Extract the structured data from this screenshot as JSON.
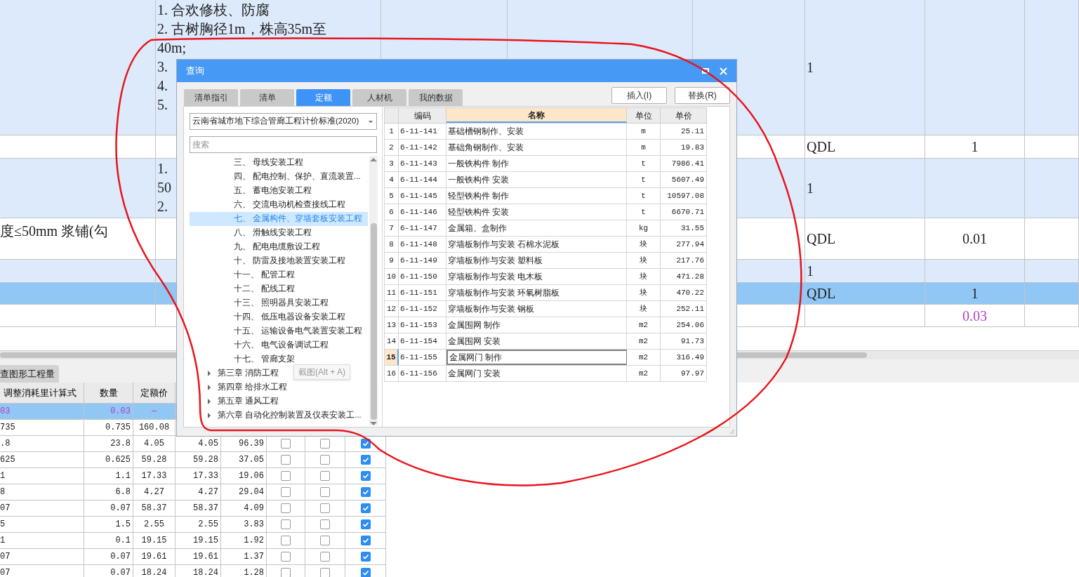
{
  "sheet": {
    "rows": [
      {
        "kind": "group",
        "selected": false,
        "modified": false,
        "column_2": [
          "1. 合欢修枝、防腐",
          "2. 古树胸径1m，株高35m至",
          "40m;",
          "3.",
          "4.",
          "5."
        ],
        "column_6": "1"
      },
      {
        "kind": "item",
        "selected": false,
        "modified": false,
        "column_6": "QDL",
        "column_7": "1"
      },
      {
        "kind": "group",
        "selected": false,
        "modified": false,
        "column_2": [
          "1.",
          "50",
          "2."
        ],
        "column_6": "1"
      },
      {
        "kind": "item",
        "selected": false,
        "modified": false,
        "column_1": "度≤50mm 浆铺(勾",
        "column_6": "QDL",
        "column_7": "0.01"
      },
      {
        "kind": "group",
        "selected": false,
        "modified": false,
        "column_6": "1"
      },
      {
        "kind": "item",
        "selected": true,
        "modified": false,
        "column_6": "QDL",
        "column_7": "1"
      },
      {
        "kind": "item",
        "selected": false,
        "modified": true,
        "column_7": "0.03"
      }
    ]
  },
  "bottom_tabs": [
    {
      "label": "查图形工程量",
      "selected": true
    }
  ],
  "bottom_table": {
    "columns": [
      "调整消耗里计算式",
      "数量",
      "定额价"
    ],
    "rows": [
      {
        "selected": true,
        "modified": true,
        "column_1": "03",
        "quantity": "0.03",
        "quota_price": "—"
      },
      {
        "selected": false,
        "modified": false,
        "column_1": "735",
        "quantity": "0.735",
        "quota_price": "160.08"
      },
      {
        "selected": false,
        "modified": false,
        "column_1": ".8",
        "quantity": "23.8",
        "quota_price": "4.05",
        "column_4": "4.05",
        "column_5": "96.39",
        "checks": [
          {
            "checked": false
          },
          {
            "checked": false
          },
          {
            "checked": true
          }
        ]
      },
      {
        "selected": false,
        "modified": false,
        "column_1": "625",
        "quantity": "0.625",
        "quota_price": "59.28",
        "column_4": "59.28",
        "column_5": "37.05",
        "checks": [
          {
            "checked": false
          },
          {
            "checked": false
          },
          {
            "checked": true
          }
        ]
      },
      {
        "selected": false,
        "modified": false,
        "column_1": "1",
        "quantity": "1.1",
        "quota_price": "17.33",
        "column_4": "17.33",
        "column_5": "19.06",
        "checks": [
          {
            "checked": false
          },
          {
            "checked": false
          },
          {
            "checked": true
          }
        ]
      },
      {
        "selected": false,
        "modified": false,
        "column_1": "8",
        "quantity": "6.8",
        "quota_price": "4.27",
        "column_4": "4.27",
        "column_5": "29.04",
        "checks": [
          {
            "checked": false
          },
          {
            "checked": false
          },
          {
            "checked": true
          }
        ]
      },
      {
        "selected": false,
        "modified": false,
        "column_1": "07",
        "quantity": "0.07",
        "quota_price": "58.37",
        "column_4": "58.37",
        "column_5": "4.09",
        "checks": [
          {
            "checked": false
          },
          {
            "checked": false
          },
          {
            "checked": true
          }
        ]
      },
      {
        "selected": false,
        "modified": false,
        "column_1": "5",
        "quantity": "1.5",
        "quota_price": "2.55",
        "column_4": "2.55",
        "column_5": "3.83",
        "checks": [
          {
            "checked": false
          },
          {
            "checked": false
          },
          {
            "checked": true
          }
        ]
      },
      {
        "selected": false,
        "modified": false,
        "column_1": "1",
        "quantity": "0.1",
        "quota_price": "19.15",
        "column_4": "19.15",
        "column_5": "1.92",
        "checks": [
          {
            "checked": false
          },
          {
            "checked": false
          },
          {
            "checked": true
          }
        ]
      },
      {
        "selected": false,
        "modified": false,
        "column_1": "07",
        "quantity": "0.07",
        "quota_price": "19.61",
        "column_4": "19.61",
        "column_5": "1.37",
        "checks": [
          {
            "checked": false
          },
          {
            "checked": false
          },
          {
            "checked": true
          }
        ]
      },
      {
        "selected": false,
        "modified": false,
        "column_1": "07",
        "quantity": "0.07",
        "quota_price": "18.24",
        "column_4": "18.24",
        "column_5": "1.28",
        "checks": [
          {
            "checked": false
          },
          {
            "checked": false
          },
          {
            "checked": true
          }
        ]
      }
    ]
  },
  "dialog": {
    "title": "查询",
    "tabs": [
      {
        "label": "清单指引",
        "selected": false
      },
      {
        "label": "清单",
        "selected": false
      },
      {
        "label": "定额",
        "selected": true
      },
      {
        "label": "人材机",
        "selected": false
      },
      {
        "label": "我的数据",
        "selected": false
      }
    ],
    "buttons": [
      "插入(I)",
      "替换(R)"
    ],
    "library": "云南省城市地下综合管廊工程计价标准(2020)",
    "search": {
      "placeholder": "搜索"
    },
    "tree": [
      {
        "kind": "section",
        "label": "三、 母线安装工程",
        "selected": false
      },
      {
        "kind": "section",
        "label": "四、 配电控制、保护、直流装置...",
        "selected": false
      },
      {
        "kind": "section",
        "label": "五、 蓄电池安装工程",
        "selected": false
      },
      {
        "kind": "section",
        "label": "六、 交流电动机检查接线工程",
        "selected": false
      },
      {
        "kind": "section",
        "label": "七、 金属构件、穿墙套板安装工程",
        "selected": true
      },
      {
        "kind": "section",
        "label": "八、 滑触线安装工程",
        "selected": false
      },
      {
        "kind": "section",
        "label": "九、 配电电缆敷设工程",
        "selected": false
      },
      {
        "kind": "section",
        "label": "十、 防雷及接地装置安装工程",
        "selected": false
      },
      {
        "kind": "section",
        "label": "十一、 配管工程",
        "selected": false
      },
      {
        "kind": "section",
        "label": "十二、 配线工程",
        "selected": false
      },
      {
        "kind": "section",
        "label": "十三、 照明器具安装工程",
        "selected": false
      },
      {
        "kind": "section",
        "label": "十四、 低压电器设备安装工程",
        "selected": false
      },
      {
        "kind": "section",
        "label": "十五、 运输设备电气装置安装工程",
        "selected": false
      },
      {
        "kind": "section",
        "label": "十六、 电气设备调试工程",
        "selected": false
      },
      {
        "kind": "section",
        "label": "十七、 管廊支架",
        "selected": false
      },
      {
        "kind": "chapter",
        "label": "第三章 消防工程",
        "selected": false,
        "expanded": false
      },
      {
        "kind": "chapter",
        "label": "第四章 给排水工程",
        "selected": false,
        "expanded": false
      },
      {
        "kind": "chapter",
        "label": "第五章 通风工程",
        "selected": false,
        "expanded": false
      },
      {
        "kind": "chapter",
        "label": "第六章 自动化控制装置及仪表安装工...",
        "selected": false,
        "expanded": false
      }
    ],
    "table": {
      "columns": [
        {
          "label": "编码",
          "selected": false
        },
        {
          "label": "名称",
          "selected": true
        },
        {
          "label": "单位",
          "selected": false
        },
        {
          "label": "单价",
          "selected": false
        }
      ],
      "rows": [
        {
          "number": "1",
          "code": "6-11-141",
          "name": "基础槽钢制作、安装",
          "unit": "m",
          "price": "25.11",
          "selected": false
        },
        {
          "number": "2",
          "code": "6-11-142",
          "name": "基础角钢制作、安装",
          "unit": "m",
          "price": "19.83",
          "selected": false
        },
        {
          "number": "3",
          "code": "6-11-143",
          "name": "一般铁构件 制作",
          "unit": "t",
          "price": "7986.41",
          "selected": false
        },
        {
          "number": "4",
          "code": "6-11-144",
          "name": "一般铁构件 安装",
          "unit": "t",
          "price": "5607.49",
          "selected": false
        },
        {
          "number": "5",
          "code": "6-11-145",
          "name": "轻型铁构件 制作",
          "unit": "t",
          "price": "10597.08",
          "selected": false
        },
        {
          "number": "6",
          "code": "6-11-146",
          "name": "轻型铁构件 安装",
          "unit": "t",
          "price": "6670.71",
          "selected": false
        },
        {
          "number": "7",
          "code": "6-11-147",
          "name": "金属箱、盒制作",
          "unit": "kg",
          "price": "31.55",
          "selected": false
        },
        {
          "number": "8",
          "code": "6-11-148",
          "name": "穿墙板制作与安装 石棉水泥板",
          "unit": "块",
          "price": "277.94",
          "selected": false
        },
        {
          "number": "9",
          "code": "6-11-149",
          "name": "穿墙板制作与安装 塑料板",
          "unit": "块",
          "price": "217.76",
          "selected": false
        },
        {
          "number": "10",
          "code": "6-11-150",
          "name": "穿墙板制作与安装 电木板",
          "unit": "块",
          "price": "471.28",
          "selected": false
        },
        {
          "number": "11",
          "code": "6-11-151",
          "name": "穿墙板制作与安装 环氧树脂板",
          "unit": "块",
          "price": "470.22",
          "selected": false
        },
        {
          "number": "12",
          "code": "6-11-152",
          "name": "穿墙板制作与安装 钢板",
          "unit": "块",
          "price": "252.11",
          "selected": false
        },
        {
          "number": "13",
          "code": "6-11-153",
          "name": "金属围网 制作",
          "unit": "m2",
          "price": "254.06",
          "selected": false
        },
        {
          "number": "14",
          "code": "6-11-154",
          "name": "金属围网 安装",
          "unit": "m2",
          "price": "91.73",
          "selected": false
        },
        {
          "number": "15",
          "code": "6-11-155",
          "name": "金属网门 制作",
          "unit": "m2",
          "price": "316.49",
          "selected": true
        },
        {
          "number": "16",
          "code": "6-11-156",
          "name": "金属网门 安装",
          "unit": "m2",
          "price": "97.97",
          "selected": false
        }
      ]
    }
  },
  "tooltip": "截图(Alt + A)"
}
